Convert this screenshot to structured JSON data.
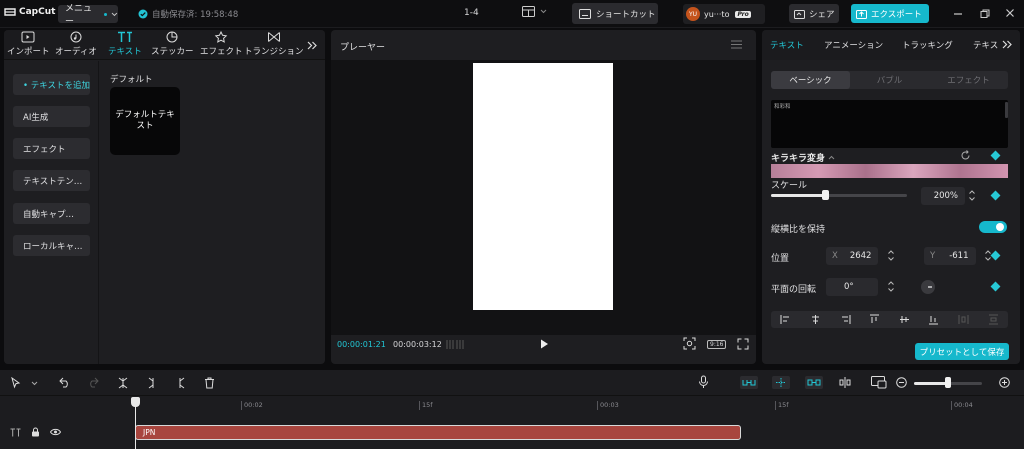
{
  "app": {
    "name": "CapCut"
  },
  "topbar": {
    "menu_label": "メニュー",
    "autosave_text": "自動保存済: 19:58:48",
    "project_name": "1-4",
    "shortcut_label": "ショートカット",
    "user_avatar": "YU",
    "user_name": "yu···to",
    "pro_badge": "Pro",
    "share_label": "シェア",
    "export_label": "エクスポート"
  },
  "left_panel": {
    "tabs": [
      {
        "label": "インポート",
        "icon": "import-icon",
        "active": false
      },
      {
        "label": "オーディオ",
        "icon": "audio-icon",
        "active": false
      },
      {
        "label": "テキスト",
        "icon": "text-icon",
        "active": true
      },
      {
        "label": "ステッカー",
        "icon": "sticker-icon",
        "active": false
      },
      {
        "label": "エフェクト",
        "icon": "effect-icon",
        "active": false
      },
      {
        "label": "トランジション",
        "icon": "transition-icon",
        "active": false
      }
    ],
    "side_items": [
      {
        "label": "• テキストを追加",
        "active": true
      },
      {
        "label": "AI生成",
        "active": false
      },
      {
        "label": "エフェクト",
        "active": false
      },
      {
        "label": "テキストテン…",
        "active": false
      },
      {
        "label": "自動キャプ…",
        "active": false
      },
      {
        "label": "ローカルキャ…",
        "active": false
      }
    ],
    "section_title": "デフォルト",
    "default_card_text": "デフォルトテキスト"
  },
  "player": {
    "title": "プレーヤー",
    "current_time": "00:00:01:21",
    "total_time": "00:00:03:12",
    "ratio": "9:16"
  },
  "right_panel": {
    "tabs": [
      "テキスト",
      "アニメーション",
      "トラッキング",
      "テキス"
    ],
    "active_tab": 0,
    "segments": [
      "ベーシック",
      "バブル",
      "エフェクト"
    ],
    "active_segment": 0,
    "preview_small_text": "和彩和",
    "sparkle_label": "キラキラ変身",
    "scale_label": "スケール",
    "scale_value": "200%",
    "scale_level": 0.4,
    "aspect_label": "縦横比を保持",
    "aspect_on": true,
    "position_label": "位置",
    "pos_x_label": "X",
    "pos_x": "2642",
    "pos_y_label": "Y",
    "pos_y": "-611",
    "rotation_label": "平面の回転",
    "rotation_value": "0°",
    "save_preset_label": "プリセットとして保存"
  },
  "timeline": {
    "ruler_labels": [
      "00:02",
      "15f",
      "00:03",
      "15f",
      "00:04"
    ],
    "clip_label": "JPN",
    "zoom_level": 0.5
  },
  "colors": {
    "accent": "#16b8cc",
    "clip": "#a8453e"
  }
}
